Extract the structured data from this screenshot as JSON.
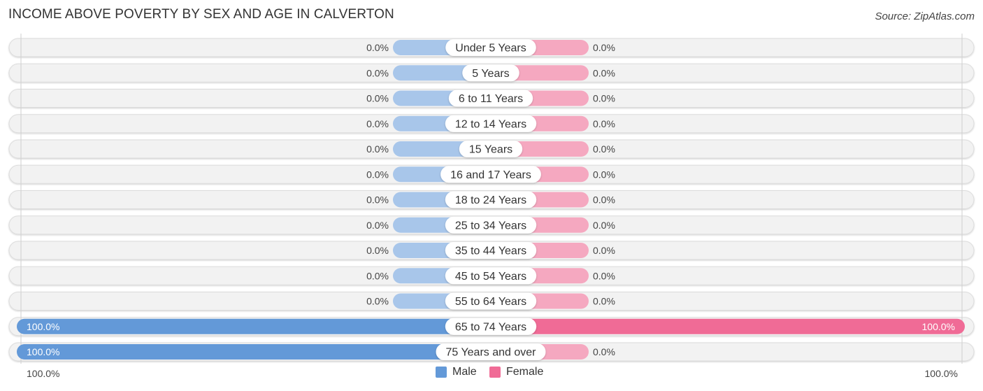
{
  "title": "INCOME ABOVE POVERTY BY SEX AND AGE IN CALVERTON",
  "source": "Source: ZipAtlas.com",
  "colors": {
    "male_full": "#6399d8",
    "male_stub": "#a8c6ea",
    "female_full": "#f06b96",
    "female_stub": "#f5a8c0",
    "track": "#f2f2f2",
    "track_border": "#dcdcdc",
    "label_bg": "#ffffff"
  },
  "legend": {
    "male": "Male",
    "female": "Female"
  },
  "axis": {
    "left_label": "100.0%",
    "right_label": "100.0%"
  },
  "chart_data": {
    "type": "bar",
    "orientation": "horizontal-diverging",
    "title": "INCOME ABOVE POVERTY BY SEX AND AGE IN CALVERTON",
    "xlabel": "",
    "ylabel": "",
    "xlim": [
      -100,
      100
    ],
    "grid": false,
    "legend_position": "bottom-center",
    "categories": [
      "Under 5 Years",
      "5 Years",
      "6 to 11 Years",
      "12 to 14 Years",
      "15 Years",
      "16 and 17 Years",
      "18 to 24 Years",
      "25 to 34 Years",
      "35 to 44 Years",
      "45 to 54 Years",
      "55 to 64 Years",
      "65 to 74 Years",
      "75 Years and over"
    ],
    "series": [
      {
        "name": "Male",
        "values": [
          0,
          0,
          0,
          0,
          0,
          0,
          0,
          0,
          0,
          0,
          0,
          100,
          100
        ],
        "labels": [
          "0.0%",
          "0.0%",
          "0.0%",
          "0.0%",
          "0.0%",
          "0.0%",
          "0.0%",
          "0.0%",
          "0.0%",
          "0.0%",
          "0.0%",
          "100.0%",
          "100.0%"
        ]
      },
      {
        "name": "Female",
        "values": [
          0,
          0,
          0,
          0,
          0,
          0,
          0,
          0,
          0,
          0,
          0,
          100,
          0
        ],
        "labels": [
          "0.0%",
          "0.0%",
          "0.0%",
          "0.0%",
          "0.0%",
          "0.0%",
          "0.0%",
          "0.0%",
          "0.0%",
          "0.0%",
          "0.0%",
          "100.0%",
          "0.0%"
        ]
      }
    ]
  }
}
